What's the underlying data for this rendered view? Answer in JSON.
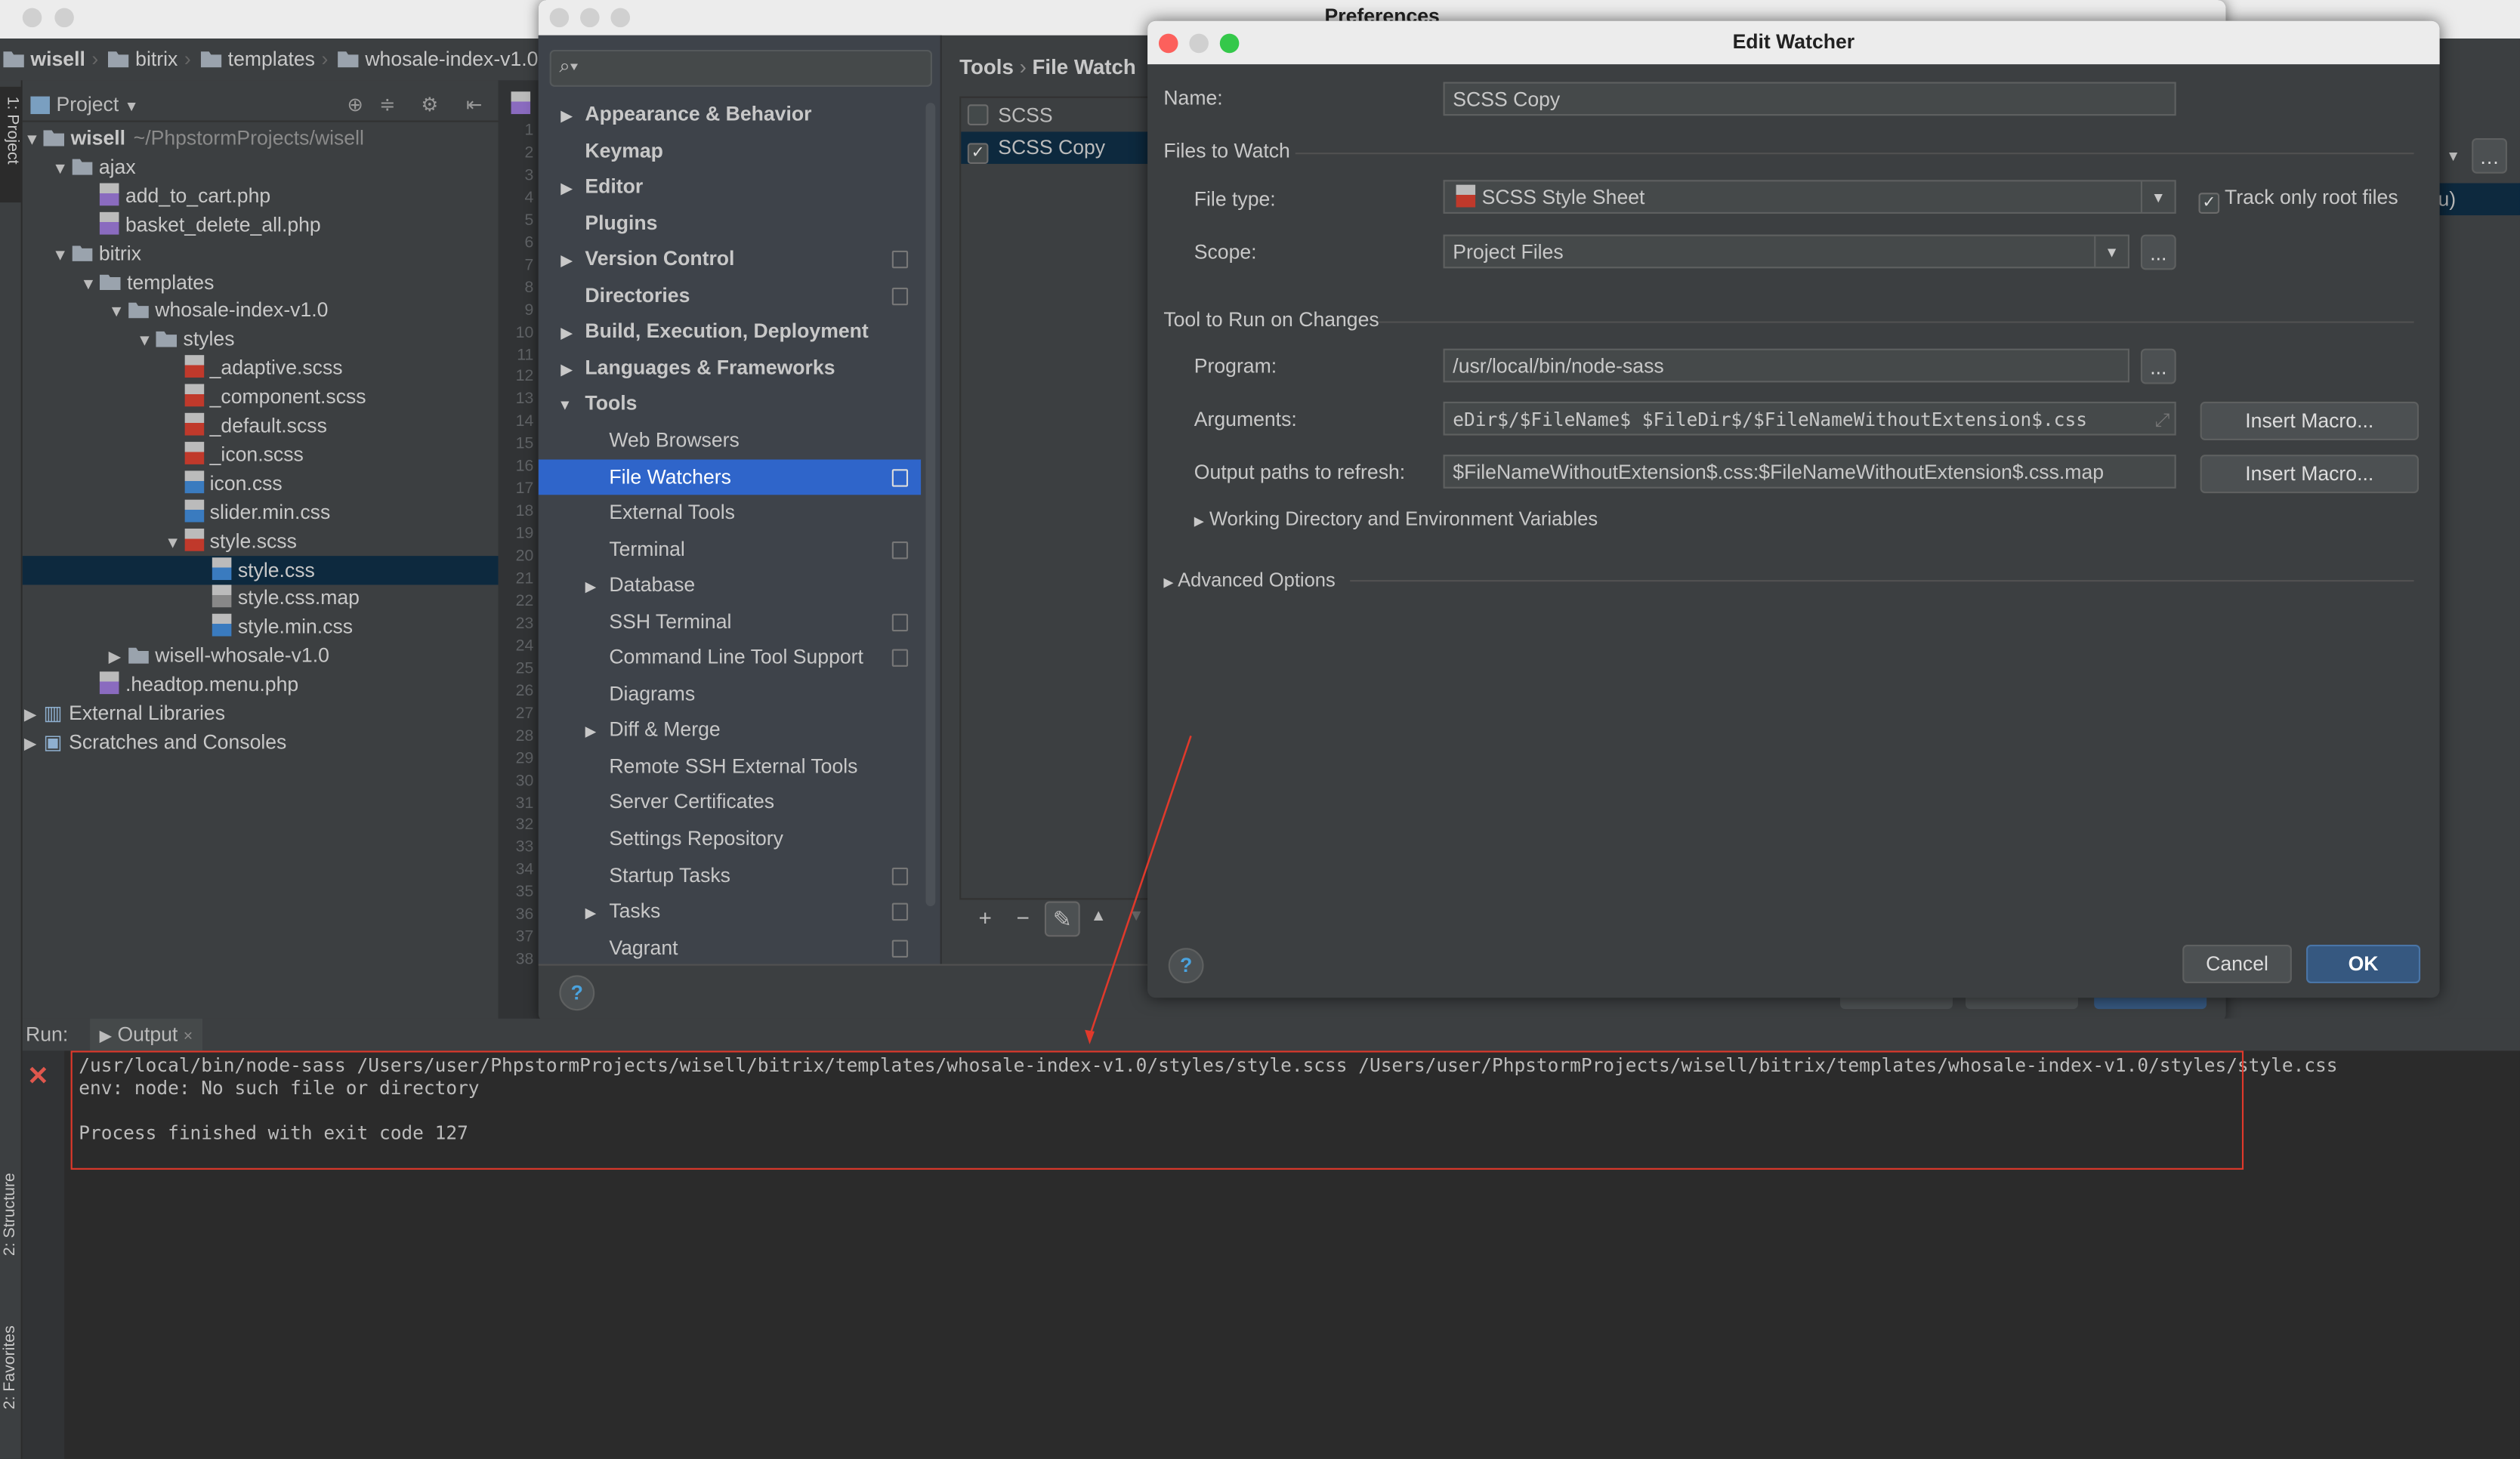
{
  "ide": {
    "breadcrumb": [
      "wisell",
      "bitrix",
      "templates",
      "whosale-index-v1.0"
    ],
    "left_tabs": [
      "1: Project",
      "2: Structure",
      "2: Favorites"
    ],
    "project_header": "Project",
    "tree": [
      {
        "label": "wisell",
        "extra": "~/PhpstormProjects/wisell",
        "depth": 0,
        "kind": "folder",
        "open": true,
        "bold": true
      },
      {
        "label": "ajax",
        "depth": 1,
        "kind": "folder",
        "open": true
      },
      {
        "label": "add_to_cart.php",
        "depth": 2,
        "kind": "php"
      },
      {
        "label": "basket_delete_all.php",
        "depth": 2,
        "kind": "php"
      },
      {
        "label": "bitrix",
        "depth": 1,
        "kind": "folder",
        "open": true
      },
      {
        "label": "templates",
        "depth": 2,
        "kind": "folder",
        "open": true
      },
      {
        "label": "whosale-index-v1.0",
        "depth": 3,
        "kind": "folder",
        "open": true
      },
      {
        "label": "styles",
        "depth": 4,
        "kind": "folder",
        "open": true
      },
      {
        "label": "_adaptive.scss",
        "depth": 5,
        "kind": "sass"
      },
      {
        "label": "_component.scss",
        "depth": 5,
        "kind": "sass"
      },
      {
        "label": "_default.scss",
        "depth": 5,
        "kind": "sass"
      },
      {
        "label": "_icon.scss",
        "depth": 5,
        "kind": "sass"
      },
      {
        "label": "icon.css",
        "depth": 5,
        "kind": "css"
      },
      {
        "label": "slider.min.css",
        "depth": 5,
        "kind": "css"
      },
      {
        "label": "style.scss",
        "depth": 5,
        "kind": "sass",
        "open": true
      },
      {
        "label": "style.css",
        "depth": 6,
        "kind": "css",
        "selected": true
      },
      {
        "label": "style.css.map",
        "depth": 6,
        "kind": "map"
      },
      {
        "label": "style.min.css",
        "depth": 6,
        "kind": "css"
      },
      {
        "label": "wisell-whosale-v1.0",
        "depth": 3,
        "kind": "folder",
        "open": false
      },
      {
        "label": ".headtop.menu.php",
        "depth": 2,
        "kind": "php"
      },
      {
        "label": "External Libraries",
        "depth": 0,
        "kind": "lib",
        "open": false
      },
      {
        "label": "Scratches and Consoles",
        "depth": 0,
        "kind": "scratch",
        "open": false
      }
    ],
    "line_count": 38,
    "run": {
      "label": "Run:",
      "tab": "Output",
      "lines": [
        "/usr/local/bin/node-sass /Users/user/PhpstormProjects/wisell/bitrix/templates/whosale-index-v1.0/styles/style.scss /Users/user/PhpstormProjects/wisell/bitrix/templates/whosale-index-v1.0/styles/style.css",
        "env: node: No such file or directory",
        "",
        "Process finished with exit code 127"
      ]
    },
    "right_peek": "u)"
  },
  "preferences": {
    "title": "Preferences",
    "breadcrumb": [
      "Tools",
      "File Watch"
    ],
    "nav": [
      {
        "label": "Appearance & Behavior",
        "bold": true,
        "arrow": true
      },
      {
        "label": "Keymap",
        "bold": true
      },
      {
        "label": "Editor",
        "bold": true,
        "arrow": true
      },
      {
        "label": "Plugins",
        "bold": true
      },
      {
        "label": "Version Control",
        "bold": true,
        "arrow": true,
        "copy": true
      },
      {
        "label": "Directories",
        "bold": true,
        "copy": true
      },
      {
        "label": "Build, Execution, Deployment",
        "bold": true,
        "arrow": true
      },
      {
        "label": "Languages & Frameworks",
        "bold": true,
        "arrow": true
      },
      {
        "label": "Tools",
        "bold": true,
        "arrow": true,
        "open": true
      },
      {
        "label": "Web Browsers",
        "sub": true
      },
      {
        "label": "File Watchers",
        "sub": true,
        "selected": true,
        "copy": true
      },
      {
        "label": "External Tools",
        "sub": true
      },
      {
        "label": "Terminal",
        "sub": true,
        "copy": true
      },
      {
        "label": "Database",
        "sub": true,
        "arrow": true
      },
      {
        "label": "SSH Terminal",
        "sub": true,
        "copy": true
      },
      {
        "label": "Command Line Tool Support",
        "sub": true,
        "copy": true
      },
      {
        "label": "Diagrams",
        "sub": true
      },
      {
        "label": "Diff & Merge",
        "sub": true,
        "arrow": true
      },
      {
        "label": "Remote SSH External Tools",
        "sub": true
      },
      {
        "label": "Server Certificates",
        "sub": true
      },
      {
        "label": "Settings Repository",
        "sub": true
      },
      {
        "label": "Startup Tasks",
        "sub": true,
        "copy": true
      },
      {
        "label": "Tasks",
        "sub": true,
        "arrow": true,
        "copy": true
      },
      {
        "label": "Vagrant",
        "sub": true,
        "copy": true
      }
    ],
    "watchers": [
      {
        "label": "SCSS",
        "checked": false
      },
      {
        "label": "SCSS Copy",
        "checked": true,
        "selected": true
      }
    ],
    "toolbar": [
      "+",
      "−",
      "✎",
      "▲",
      "▼"
    ]
  },
  "dialog": {
    "title": "Edit Watcher",
    "name_label": "Name:",
    "name_value": "SCSS Copy",
    "files_section": "Files to Watch",
    "file_type_label": "File type:",
    "file_type_value": "SCSS Style Sheet",
    "track_root_label": "Track only root files",
    "track_root_checked": true,
    "scope_label": "Scope:",
    "scope_value": "Project Files",
    "tool_section": "Tool to Run on Changes",
    "program_label": "Program:",
    "program_value": "/usr/local/bin/node-sass",
    "arguments_label": "Arguments:",
    "arguments_value": "eDir$/$FileName$ $FileDir$/$FileNameWithoutExtension$.css",
    "output_label": "Output paths to refresh:",
    "output_value": "$FileNameWithoutExtension$.css:$FileNameWithoutExtension$.css.map",
    "insert_macro": "Insert Macro...",
    "ellipsis": "...",
    "working_dir": "Working Directory and Environment Variables",
    "advanced": "Advanced Options",
    "cancel": "Cancel",
    "ok": "OK"
  },
  "colors": {
    "selection": "#2f65ca",
    "annotation": "#e0392b",
    "ok_button": "#365880"
  }
}
